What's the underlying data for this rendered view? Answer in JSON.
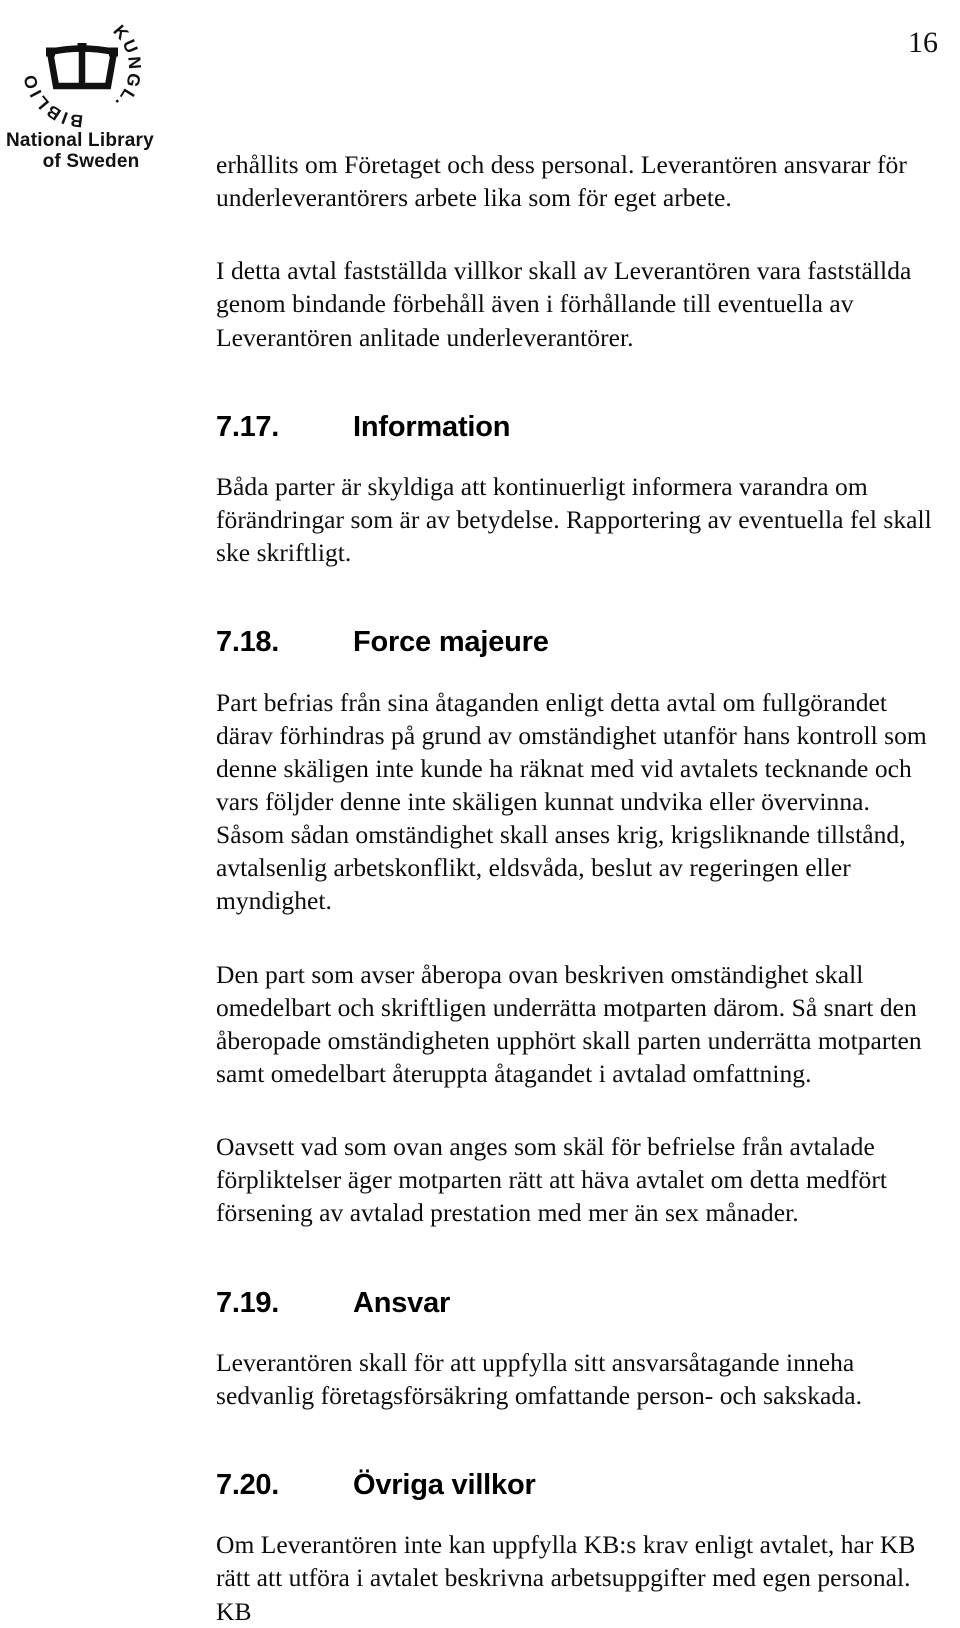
{
  "document": {
    "folio": "16",
    "logo": {
      "seal_ring_text": "KUNGL. BIBLIOTEKET.",
      "wordmark_line1": "National Library",
      "wordmark_line2": "of Sweden"
    },
    "blocks": [
      {
        "kind": "paragraph",
        "name": "paragraph-continued-personal",
        "text": "erhållits om Företaget och dess personal. Leverantören ansvarar för underleverantörers arbete lika som för eget arbete."
      },
      {
        "kind": "paragraph",
        "name": "paragraph-avtal-villkor",
        "text": "I detta avtal fastställda villkor skall av Leverantören vara fastställda genom bindande förbehåll även i förhållande till eventuella av Leverantören anlitade underleverantörer."
      },
      {
        "kind": "heading",
        "name": "heading-7-17",
        "number": "7.17.",
        "title": "Information"
      },
      {
        "kind": "paragraph",
        "name": "paragraph-information",
        "text": "Båda parter är skyldiga att kontinuerligt informera varandra om förändringar som är av betydelse. Rapportering av eventuella fel skall ske skriftligt."
      },
      {
        "kind": "heading",
        "name": "heading-7-18",
        "number": "7.18.",
        "title": "Force majeure"
      },
      {
        "kind": "paragraph",
        "name": "paragraph-force-majeure-definition",
        "text": "Part befrias från sina åtaganden enligt detta avtal om fullgörandet därav förhindras på grund av omständighet utanför hans kontroll som denne skäligen inte kunde ha räknat med vid avtalets tecknande och vars följder denne inte skäligen kunnat undvika eller övervinna. Såsom sådan omständighet skall anses krig, krigsliknande tillstånd, avtalsenlig arbetskonflikt, eldsvåda, beslut av regeringen eller myndighet."
      },
      {
        "kind": "paragraph",
        "name": "paragraph-force-majeure-notice",
        "text": "Den part som avser åberopa ovan beskriven omständighet skall omedelbart och skriftligen underrätta motparten därom. Så snart den åberopade omständigheten upphört skall parten underrätta motparten samt omedelbart återuppta åtagandet i avtalad omfattning."
      },
      {
        "kind": "paragraph",
        "name": "paragraph-force-majeure-termination",
        "text": "Oavsett vad som ovan anges som skäl för befrielse från avtalade förpliktelser äger motparten rätt att häva avtalet om detta medfört försening av avtalad prestation med mer än sex månader."
      },
      {
        "kind": "heading",
        "name": "heading-7-19",
        "number": "7.19.",
        "title": "Ansvar"
      },
      {
        "kind": "paragraph",
        "name": "paragraph-ansvar",
        "text": "Leverantören skall för att uppfylla sitt ansvarsåtagande inneha sedvanlig företagsförsäkring omfattande person- och sakskada."
      },
      {
        "kind": "heading",
        "name": "heading-7-20",
        "number": "7.20.",
        "title": "Övriga villkor"
      },
      {
        "kind": "paragraph",
        "name": "paragraph-ovriga-villkor",
        "text": "Om Leverantören inte kan uppfylla KB:s krav enligt avtalet, har KB rätt att utföra i avtalet beskrivna arbetsuppgifter med egen personal. KB"
      }
    ]
  }
}
